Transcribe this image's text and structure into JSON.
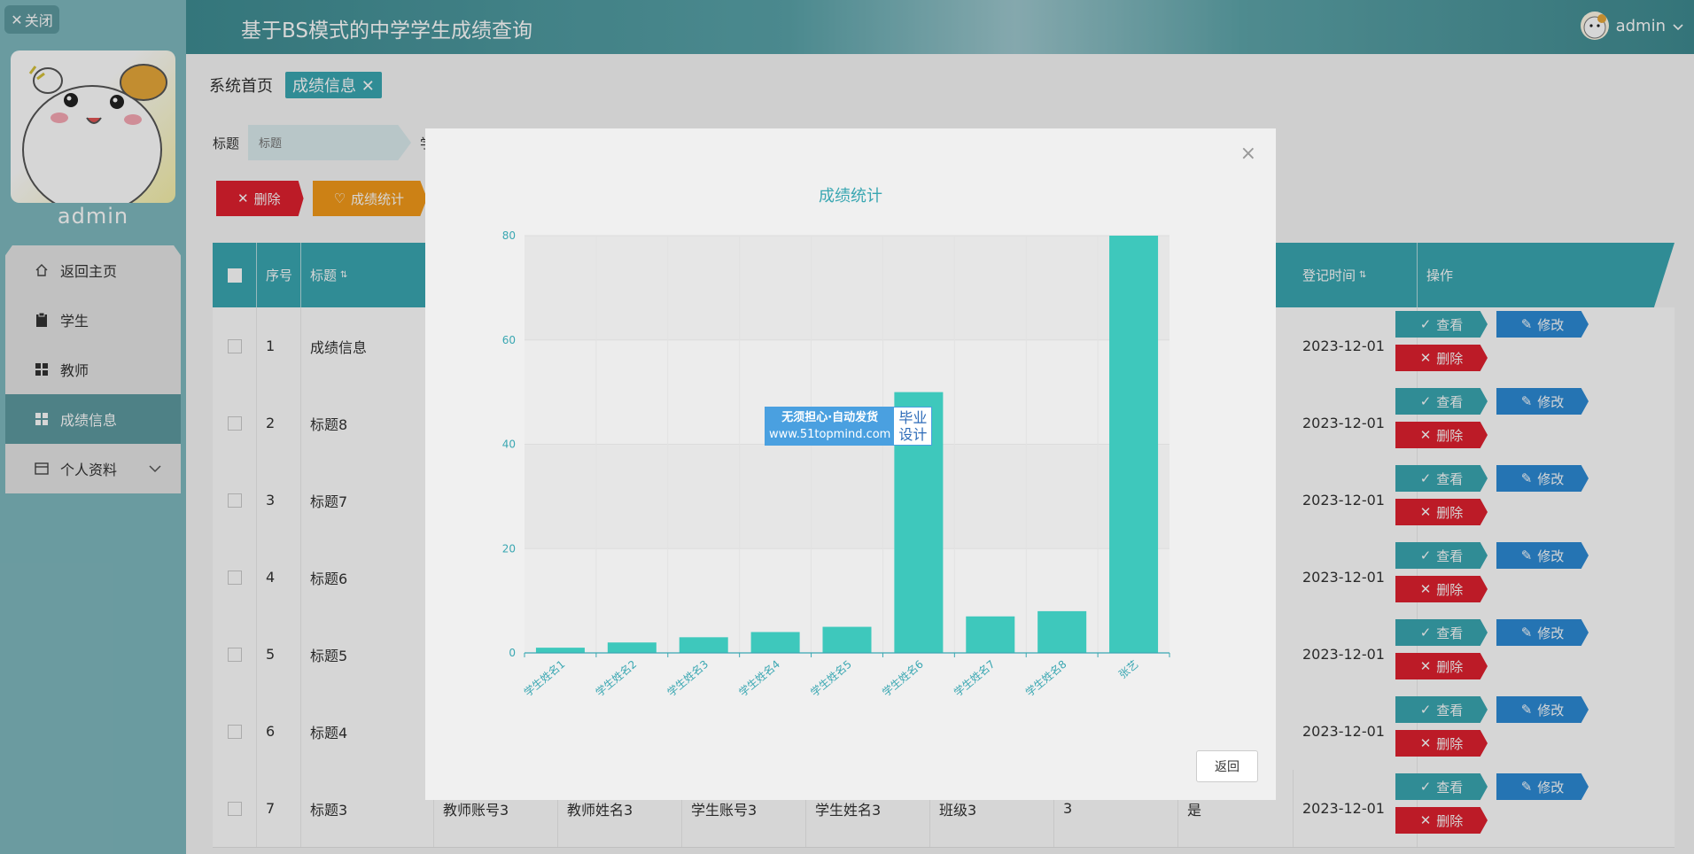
{
  "sidebar": {
    "close_label": "关闭",
    "user_name": "admin",
    "menu": [
      {
        "label": "返回主页",
        "icon": "home-icon"
      },
      {
        "label": "学生",
        "icon": "clipboard-icon"
      },
      {
        "label": "教师",
        "icon": "grid-icon"
      },
      {
        "label": "成绩信息",
        "icon": "grid-icon",
        "active": true
      },
      {
        "label": "个人资料",
        "icon": "card-icon"
      }
    ]
  },
  "header": {
    "title": "基于BS模式的中学学生成绩查询",
    "user": "admin"
  },
  "breadcrumb": {
    "home": "系统首页",
    "current": "成绩信息"
  },
  "search": {
    "title_label": "标题",
    "title_placeholder": "标题",
    "second_label": "学"
  },
  "toolbar": {
    "delete_label": "删除",
    "stats_label": "成绩统计"
  },
  "table": {
    "headers": {
      "seq": "序号",
      "title": "标题",
      "reg_time": "登记时间",
      "ops": "操作"
    },
    "rows": [
      {
        "seq": "1",
        "title": "成绩信息",
        "time": "2023-12-01"
      },
      {
        "seq": "2",
        "title": "标题8",
        "time": "2023-12-01"
      },
      {
        "seq": "3",
        "title": "标题7",
        "time": "2023-12-01"
      },
      {
        "seq": "4",
        "title": "标题6",
        "time": "2023-12-01"
      },
      {
        "seq": "5",
        "title": "标题5",
        "time": "2023-12-01"
      },
      {
        "seq": "6",
        "title": "标题4",
        "time": "2023-12-01"
      },
      {
        "seq": "7",
        "title": "标题3",
        "teacher_acc": "教师账号3",
        "teacher_name": "教师姓名3",
        "student_acc": "学生账号3",
        "student_name": "学生姓名3",
        "class": "班级3",
        "score": "3",
        "flag": "是",
        "time": "2023-12-01"
      }
    ],
    "op_view": "查看",
    "op_edit": "修改",
    "op_delete": "删除"
  },
  "dialog": {
    "return_label": "返回",
    "watermark": {
      "line1": "无须担心·自动发货",
      "line2": "www.51topmind.com",
      "right1": "毕业",
      "right2": "设计"
    }
  },
  "chart_data": {
    "type": "bar",
    "title": "成绩统计",
    "categories": [
      "学生姓名1",
      "学生姓名2",
      "学生姓名3",
      "学生姓名4",
      "学生姓名5",
      "学生姓名6",
      "学生姓名7",
      "学生姓名8",
      "张艺"
    ],
    "values": [
      1,
      2,
      3,
      4,
      5,
      50,
      7,
      8,
      80
    ],
    "ylim": [
      0,
      80
    ],
    "yticks": [
      0,
      20,
      40,
      60,
      80
    ],
    "color": "#3ec8bc",
    "grid": true
  }
}
